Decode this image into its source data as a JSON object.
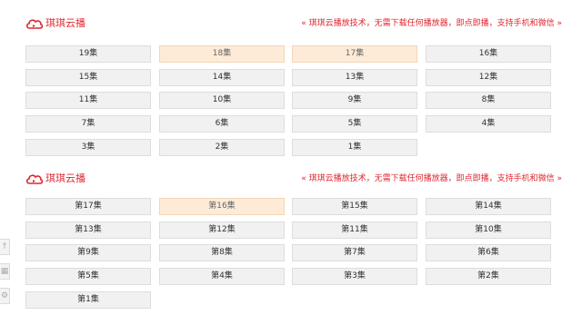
{
  "colors": {
    "brand": "#e0262f",
    "active_bg": "#fdebd8",
    "button_bg": "#f1f1f1"
  },
  "sections": [
    {
      "logo_text": "琪琪云播",
      "tagline": "« 琪琪云播放技术，无需下载任何播放器，即点即播，支持手机和微信 »",
      "episodes": [
        {
          "label": "19集",
          "active": false
        },
        {
          "label": "18集",
          "active": true
        },
        {
          "label": "17集",
          "active": true
        },
        {
          "label": "16集",
          "active": false
        },
        {
          "label": "15集",
          "active": false
        },
        {
          "label": "14集",
          "active": false
        },
        {
          "label": "13集",
          "active": false
        },
        {
          "label": "12集",
          "active": false
        },
        {
          "label": "11集",
          "active": false
        },
        {
          "label": "10集",
          "active": false
        },
        {
          "label": "9集",
          "active": false
        },
        {
          "label": "8集",
          "active": false
        },
        {
          "label": "7集",
          "active": false
        },
        {
          "label": "6集",
          "active": false
        },
        {
          "label": "5集",
          "active": false
        },
        {
          "label": "4集",
          "active": false
        },
        {
          "label": "3集",
          "active": false
        },
        {
          "label": "2集",
          "active": false
        },
        {
          "label": "1集",
          "active": false
        }
      ]
    },
    {
      "logo_text": "琪琪云播",
      "tagline": "« 琪琪云播放技术，无需下载任何播放器，即点即播，支持手机和微信 »",
      "episodes": [
        {
          "label": "第17集",
          "active": false
        },
        {
          "label": "第16集",
          "active": true
        },
        {
          "label": "第15集",
          "active": false
        },
        {
          "label": "第14集",
          "active": false
        },
        {
          "label": "第13集",
          "active": false
        },
        {
          "label": "第12集",
          "active": false
        },
        {
          "label": "第11集",
          "active": false
        },
        {
          "label": "第10集",
          "active": false
        },
        {
          "label": "第9集",
          "active": false
        },
        {
          "label": "第8集",
          "active": false
        },
        {
          "label": "第7集",
          "active": false
        },
        {
          "label": "第6集",
          "active": false
        },
        {
          "label": "第5集",
          "active": false
        },
        {
          "label": "第4集",
          "active": false
        },
        {
          "label": "第3集",
          "active": false
        },
        {
          "label": "第2集",
          "active": false
        },
        {
          "label": "第1集",
          "active": false
        }
      ]
    }
  ],
  "left_tools": [
    {
      "icon": "arrow-up-icon",
      "glyph": "↑"
    },
    {
      "icon": "grid-icon",
      "glyph": "▦"
    },
    {
      "icon": "gear-icon",
      "glyph": "⚙"
    }
  ]
}
